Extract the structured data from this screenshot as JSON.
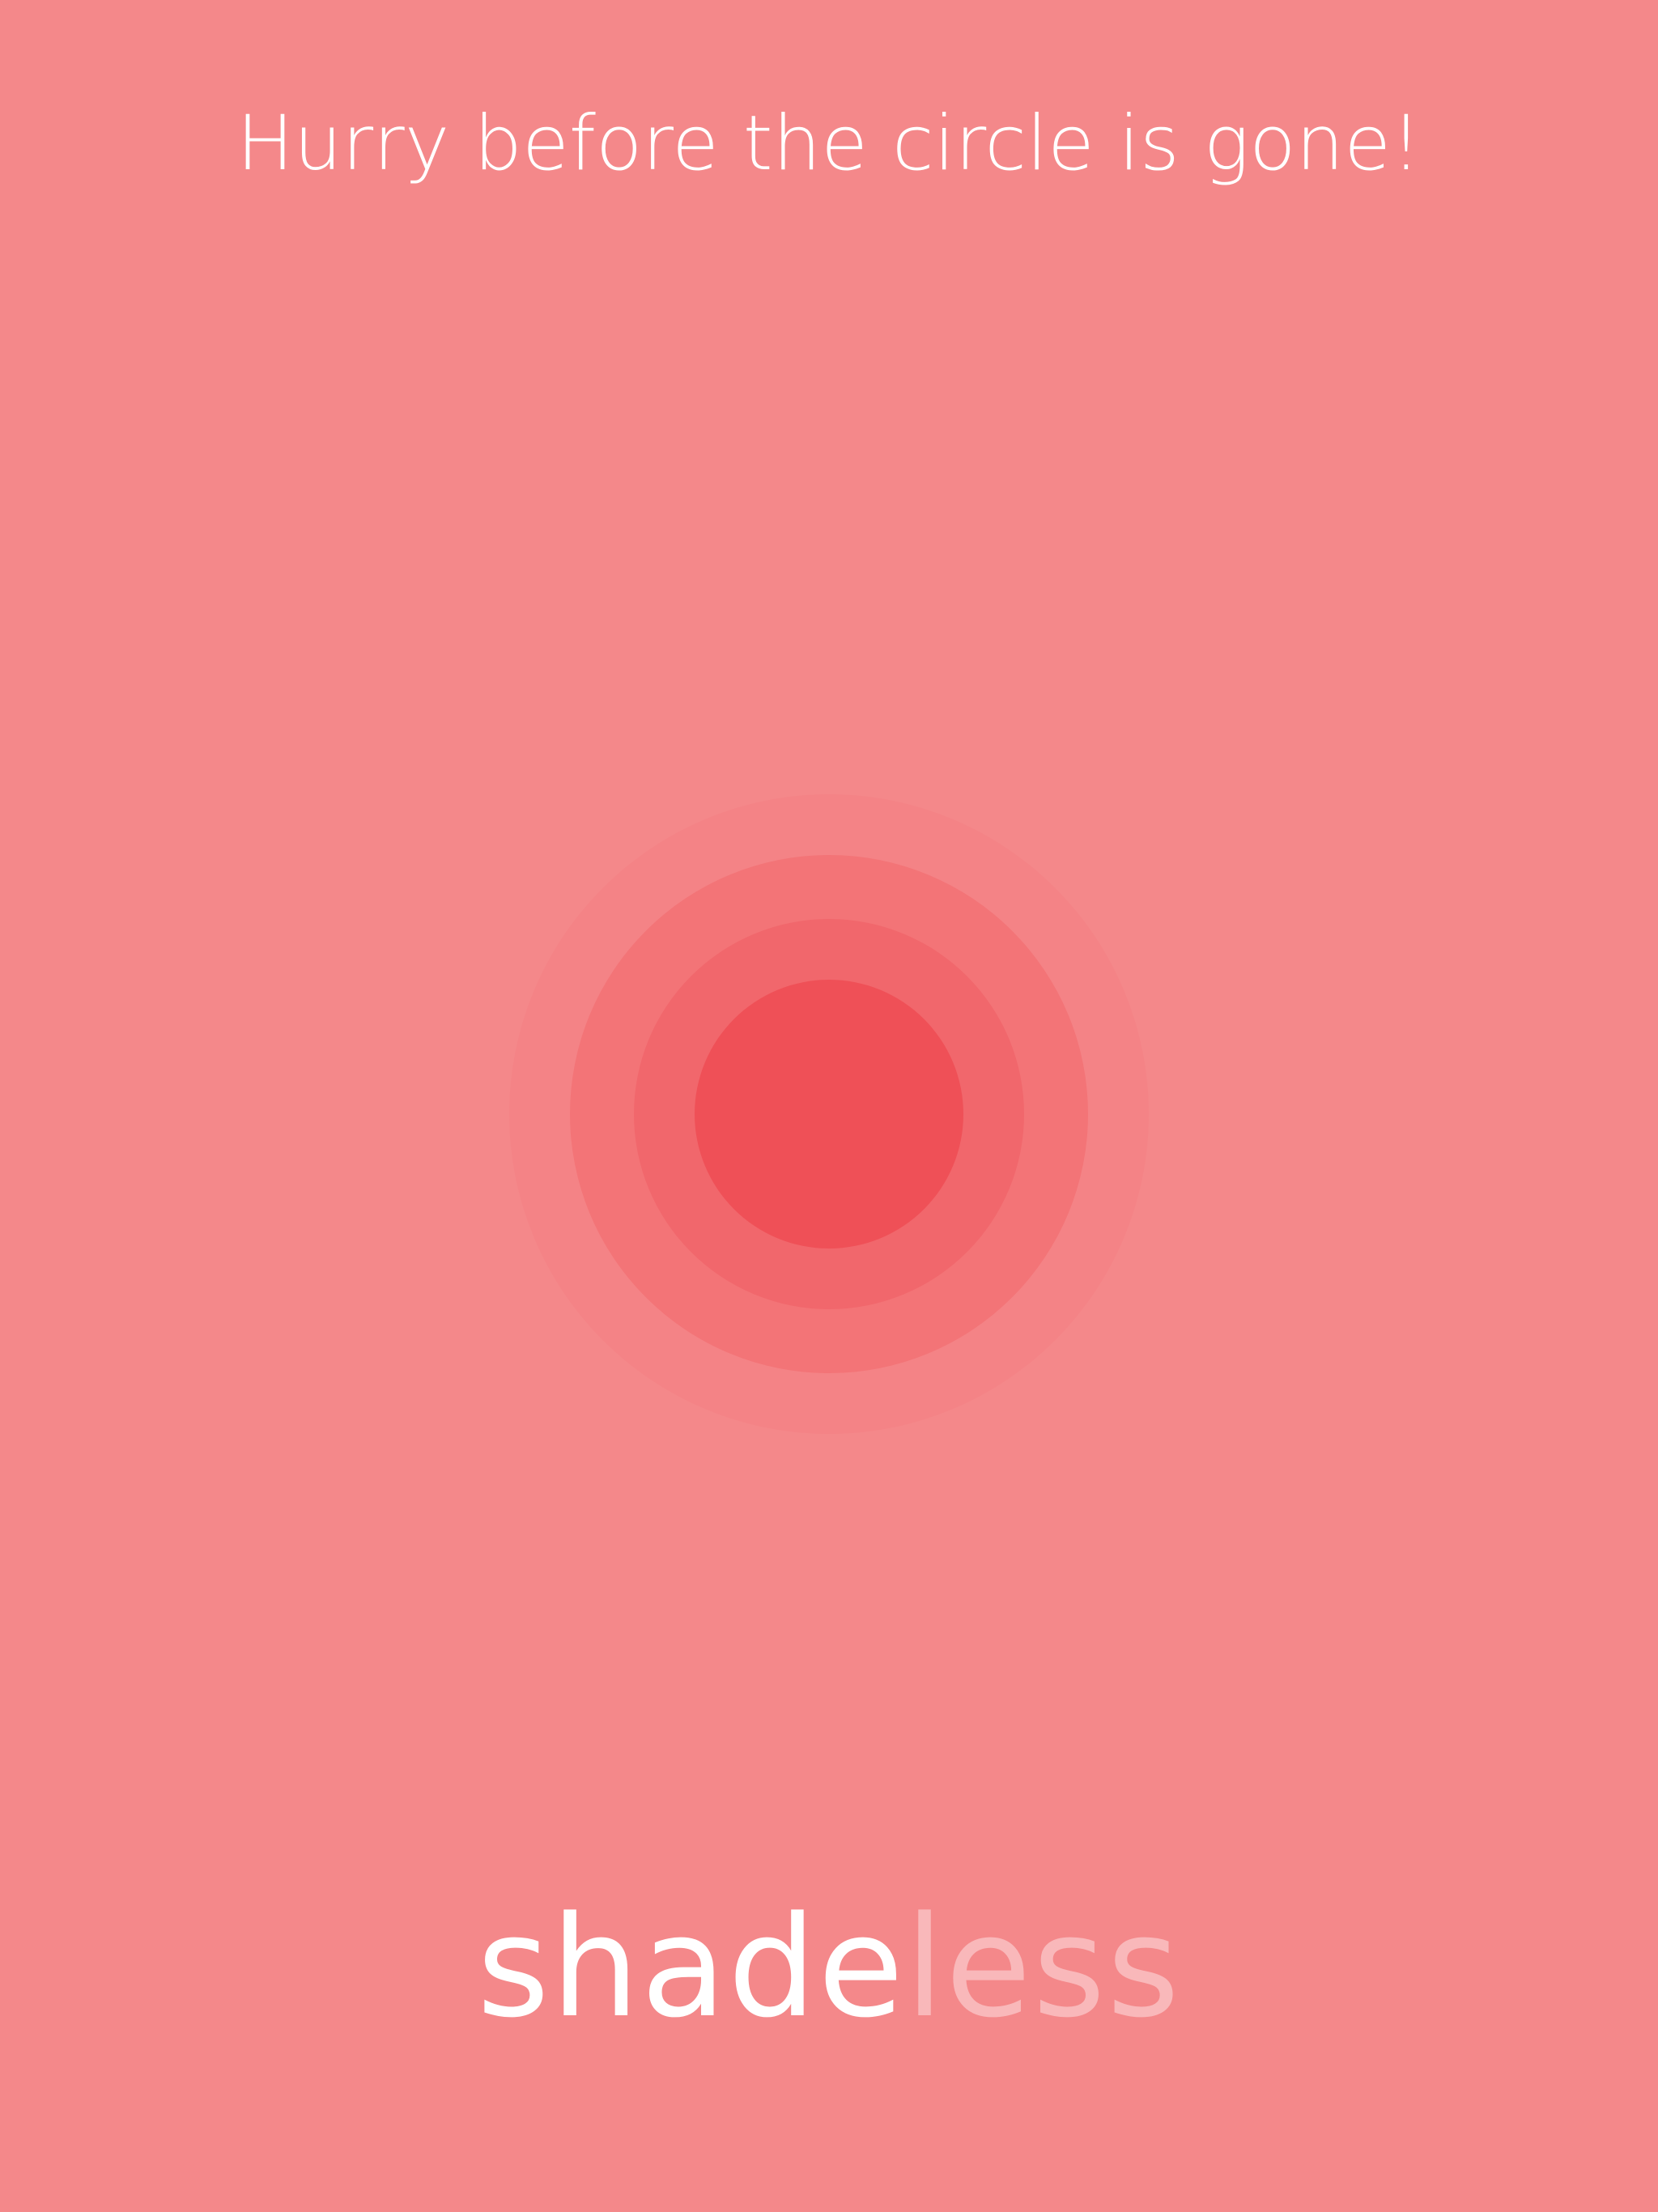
{
  "prompt_text": "Hurry before the circle is gone!",
  "logo": {
    "part1": "shade",
    "part2": "less"
  },
  "colors": {
    "background": "#f4888a",
    "ring_outer": "#f48386",
    "ring_middle": "#f37477",
    "ring_inner": "#f1676c",
    "target": "#ef5057",
    "text": "#ffffff",
    "logo_faint": "#f9b8ba"
  }
}
